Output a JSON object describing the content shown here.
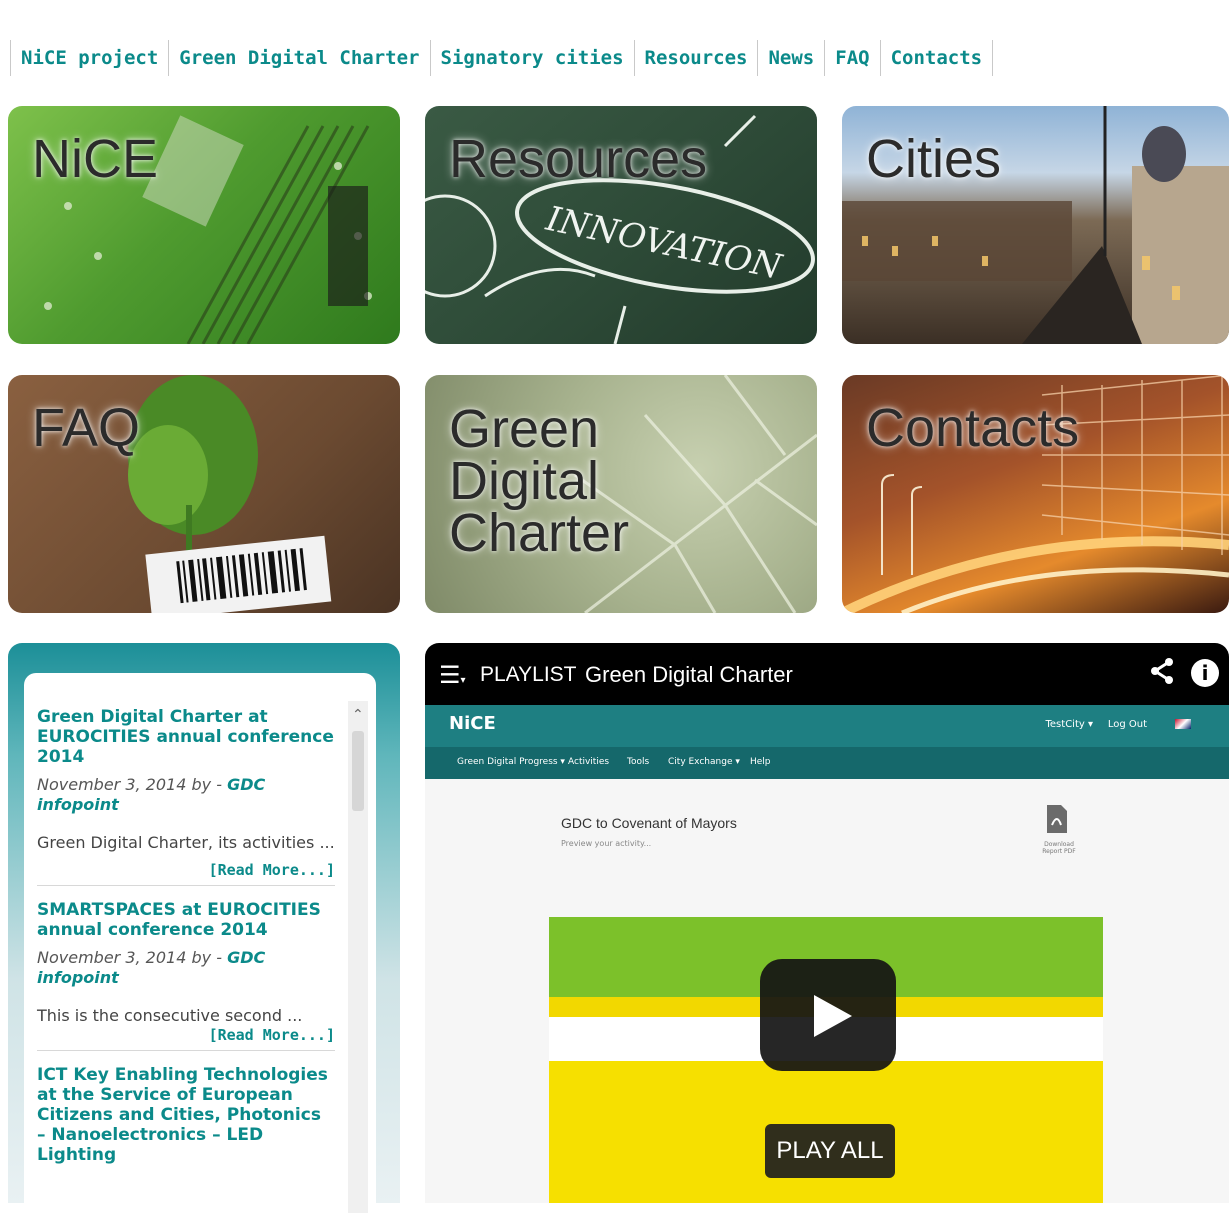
{
  "nav": {
    "items": [
      "NiCE project",
      "Green Digital Charter",
      "Signatory cities",
      "Resources",
      "News",
      "FAQ",
      "Contacts"
    ]
  },
  "tiles": {
    "nice": "NiCE",
    "resources": "Resources",
    "cities": "Cities",
    "faq": "FAQ",
    "gdc": "Green\nDigital\nCharter",
    "contacts": "Contacts"
  },
  "news": {
    "items": [
      {
        "title": "Green Digital Charter at EUROCITIES annual conference 2014",
        "date": "November 3, 2014 by -",
        "author": "GDC infopoint",
        "excerpt": "Green Digital Charter, its activities ...",
        "read_more": "[Read More...]"
      },
      {
        "title": "SMARTSPACES at EUROCITIES annual conference 2014",
        "date": "November 3, 2014 by -",
        "author": "GDC infopoint",
        "excerpt": "This is the consecutive second ...",
        "read_more": "[Read More...]"
      },
      {
        "title": "ICT Key Enabling Technologies at the Service of European Citizens and Cities, Photonics – Nanoelectronics – LED Lighting"
      }
    ]
  },
  "video": {
    "playlist_label": "PLAYLIST",
    "title": "Green Digital Charter",
    "play_all": "PLAY ALL",
    "embedded_page": {
      "logo": "NiCE",
      "user_menu": "TestCity ▾",
      "logout": "Log Out",
      "menu": [
        "Green Digital Progress ▾",
        "Activities",
        "Tools",
        "City Exchange ▾",
        "Help"
      ],
      "heading": "GDC to Covenant of Mayors",
      "subheading": "Preview your activity...",
      "pdf_label": "Download Report PDF"
    }
  }
}
